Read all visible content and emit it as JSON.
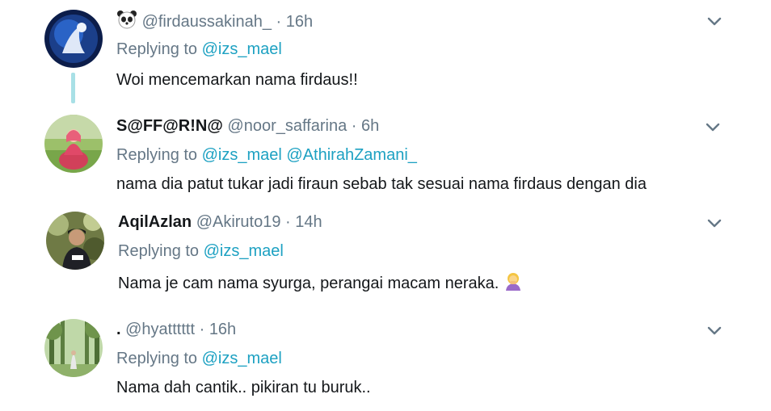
{
  "tweets": [
    {
      "name": "",
      "handle": "@firdaussakinah_",
      "time": "16h",
      "replying_label": "Replying to",
      "mentions": [
        "@izs_mael"
      ],
      "text": "Woi mencemarkan nama firdaus!!",
      "name_emoji": "panda-face-icon"
    },
    {
      "name": "S@FF@R!N@",
      "handle": "@noor_saffarina",
      "time": "6h",
      "replying_label": "Replying to",
      "mentions": [
        "@izs_mael",
        "@AthirahZamani_"
      ],
      "text": "nama dia patut tukar jadi firaun sebab tak sesuai nama firdaus dengan dia"
    },
    {
      "name": "AqilAzlan",
      "handle": "@Akiruto19",
      "time": "14h",
      "replying_label": "Replying to",
      "mentions": [
        "@izs_mael"
      ],
      "text": "Nama je cam nama syurga, perangai macam neraka.",
      "text_emoji": "person-facepalming-icon"
    },
    {
      "name": ".",
      "handle": "@hyatttttt",
      "time": "16h",
      "replying_label": "Replying to",
      "mentions": [
        "@izs_mael"
      ],
      "text": "Nama dah cantik.. pikiran tu buruk.."
    }
  ],
  "separator": "·",
  "colors": {
    "text": "#14171a",
    "secondary": "#657786",
    "mention": "#1da1c2",
    "thread_line": "#a8e0e6"
  }
}
